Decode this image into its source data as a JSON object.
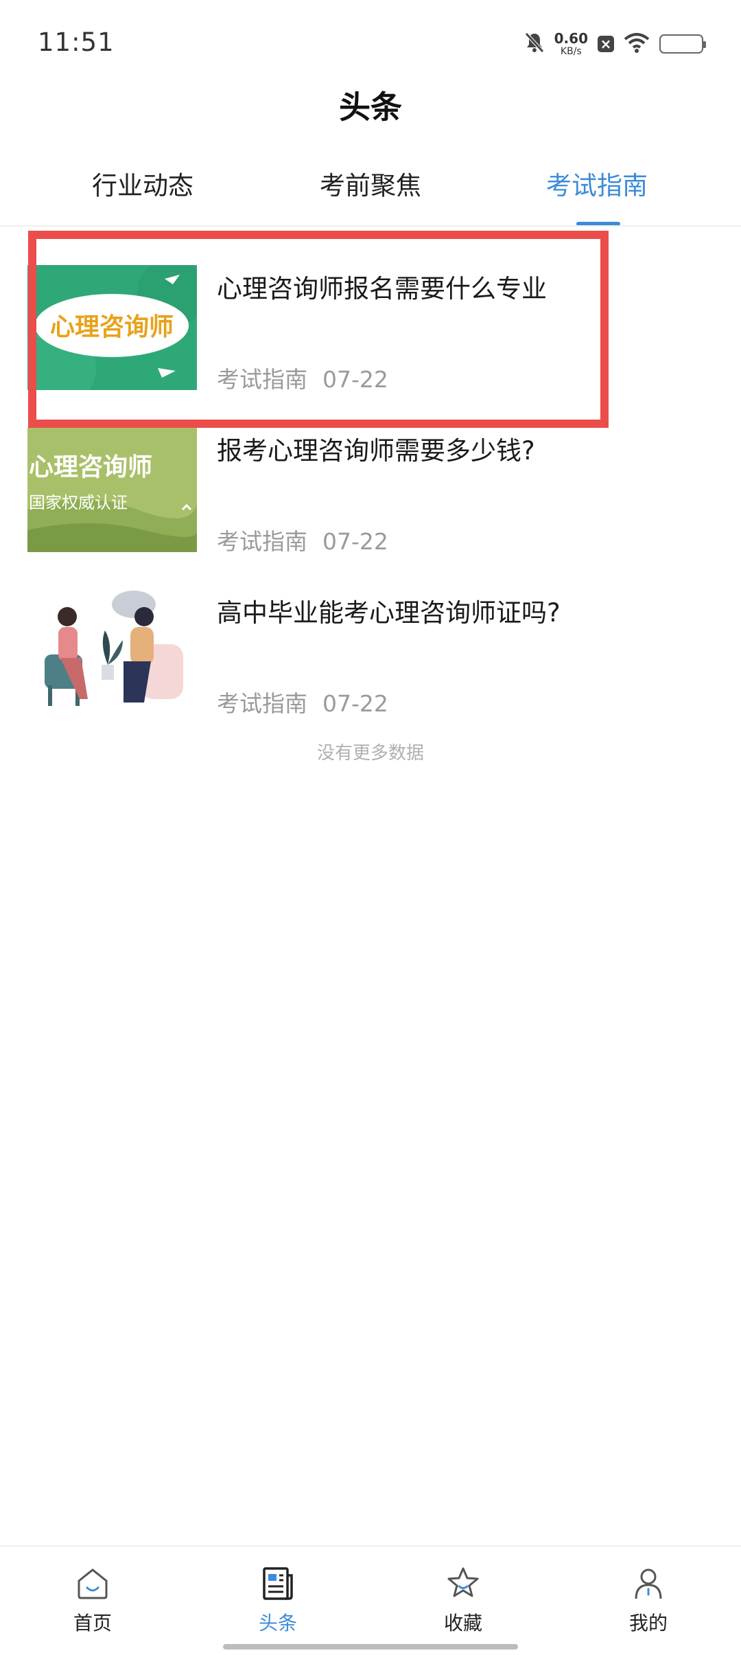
{
  "status_bar": {
    "time": "11:51",
    "net_speed_value": "0.60",
    "net_speed_unit": "KB/s",
    "icons": [
      "mute-icon",
      "close-box-icon",
      "wifi-icon",
      "battery-icon"
    ]
  },
  "header": {
    "title": "头条"
  },
  "tabs": [
    {
      "label": "行业动态",
      "active": false
    },
    {
      "label": "考前聚焦",
      "active": false
    },
    {
      "label": "考试指南",
      "active": true
    }
  ],
  "articles": [
    {
      "title": "心理咨询师报名需要什么专业",
      "category": "考试指南",
      "date": "07-22",
      "thumb_text": "心理咨询师"
    },
    {
      "title": "报考心理咨询师需要多少钱?",
      "category": "考试指南",
      "date": "07-22",
      "thumb_text": "心理咨询师",
      "thumb_subtext": "国家权威认证"
    },
    {
      "title": "高中毕业能考心理咨询师证吗?",
      "category": "考试指南",
      "date": "07-22"
    }
  ],
  "no_more_text": "没有更多数据",
  "bottom_nav": [
    {
      "label": "首页",
      "icon": "home-icon",
      "active": false
    },
    {
      "label": "头条",
      "icon": "news-icon",
      "active": true
    },
    {
      "label": "收藏",
      "icon": "star-icon",
      "active": false
    },
    {
      "label": "我的",
      "icon": "profile-icon",
      "active": false
    }
  ],
  "colors": {
    "accent": "#3c8bd8",
    "highlight": "#eb4d4b"
  }
}
